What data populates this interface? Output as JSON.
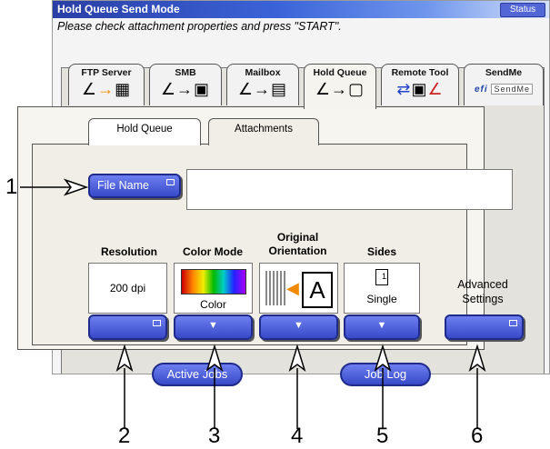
{
  "window": {
    "title": "Hold Queue Send Mode",
    "status_label": "Status",
    "message": "Please check attachment properties and press \"START\"."
  },
  "function_tabs": [
    {
      "label": "FTP Server",
      "icon": "ftp-server-icon"
    },
    {
      "label": "SMB",
      "icon": "smb-icon"
    },
    {
      "label": "Mailbox",
      "icon": "mailbox-icon"
    },
    {
      "label": "Hold Queue",
      "icon": "hold-queue-icon",
      "active": true
    },
    {
      "label": "Remote Tool",
      "icon": "remote-tool-icon"
    },
    {
      "label": "SendMe",
      "icon": "sendme-icon",
      "logo": "efi SendMe"
    }
  ],
  "sub_tabs": [
    {
      "label": "Hold Queue"
    },
    {
      "label": "Attachments",
      "active": true
    }
  ],
  "file_name": {
    "button_label": "File Name",
    "value": ""
  },
  "settings": {
    "resolution": {
      "label": "Resolution",
      "value": "200 dpi"
    },
    "color_mode": {
      "label": "Color Mode",
      "value": "Color"
    },
    "orientation": {
      "label_line1": "Original",
      "label_line2": "Orientation",
      "glyph": "A"
    },
    "sides": {
      "label": "Sides",
      "value": "Single",
      "page_number": "1"
    },
    "advanced": {
      "label_line1": "Advanced",
      "label_line2": "Settings"
    }
  },
  "bottom_buttons": {
    "active_jobs": "Active Jobs",
    "job_log": "Job Log"
  },
  "callouts": [
    "1",
    "2",
    "3",
    "4",
    "5",
    "6"
  ],
  "colors": {
    "title_bar": "#2a3fa5",
    "button_blue": "#3849c8",
    "panel": "#f7f5ef"
  }
}
